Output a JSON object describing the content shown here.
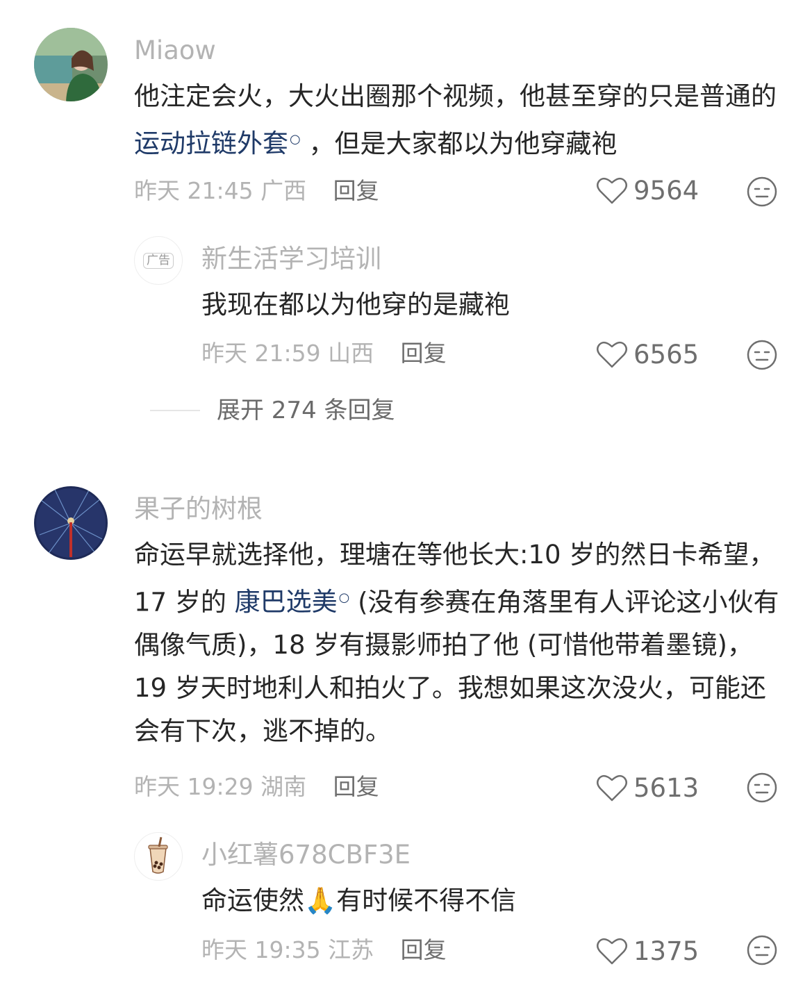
{
  "comments": [
    {
      "user": "Miaow",
      "text_before": "他注定会火，大火出圈那个视频，他甚至穿的只是普通的 ",
      "link": "运动拉链外套",
      "text_after": " ，但是大家都以为他穿藏袍",
      "time": "昨天 21:45",
      "location": "广西",
      "reply_label": "回复",
      "likes": "9564",
      "replies": [
        {
          "user": "新生活学习培训",
          "ad_badge": "广告",
          "text": "我现在都以为他穿的是藏袍",
          "time": "昨天 21:59",
          "location": "山西",
          "reply_label": "回复",
          "likes": "6565"
        }
      ],
      "expand_label": "展开 274 条回复"
    },
    {
      "user": "果子的树根",
      "text_before": "命运早就选择他，理塘在等他长大:10 岁的然日卡希望，17 岁的 ",
      "link": "康巴选美",
      "text_after": " (没有参赛在角落里有人评论这小伙有偶像气质)，18 岁有摄影师拍了他 (可惜他带着墨镜)，19 岁天时地利人和拍火了。我想如果这次没火，可能还会有下次，逃不掉的。",
      "time": "昨天 19:29",
      "location": "湖南",
      "reply_label": "回复",
      "likes": "5613",
      "replies": [
        {
          "user": "小红薯678CBF3E",
          "text_before": "命运使然",
          "emoji": "🙏",
          "text_after": "有时候不得不信",
          "time": "昨天 19:35",
          "location": "江苏",
          "reply_label": "回复",
          "likes": "1375"
        }
      ]
    }
  ],
  "icons": {
    "like": "heart-outline-icon",
    "dislike": "neutral-face-icon",
    "search_link": "magnifier-icon"
  },
  "colors": {
    "link": "#1f3a68",
    "meta": "#b3b3b3",
    "text": "#262626"
  }
}
